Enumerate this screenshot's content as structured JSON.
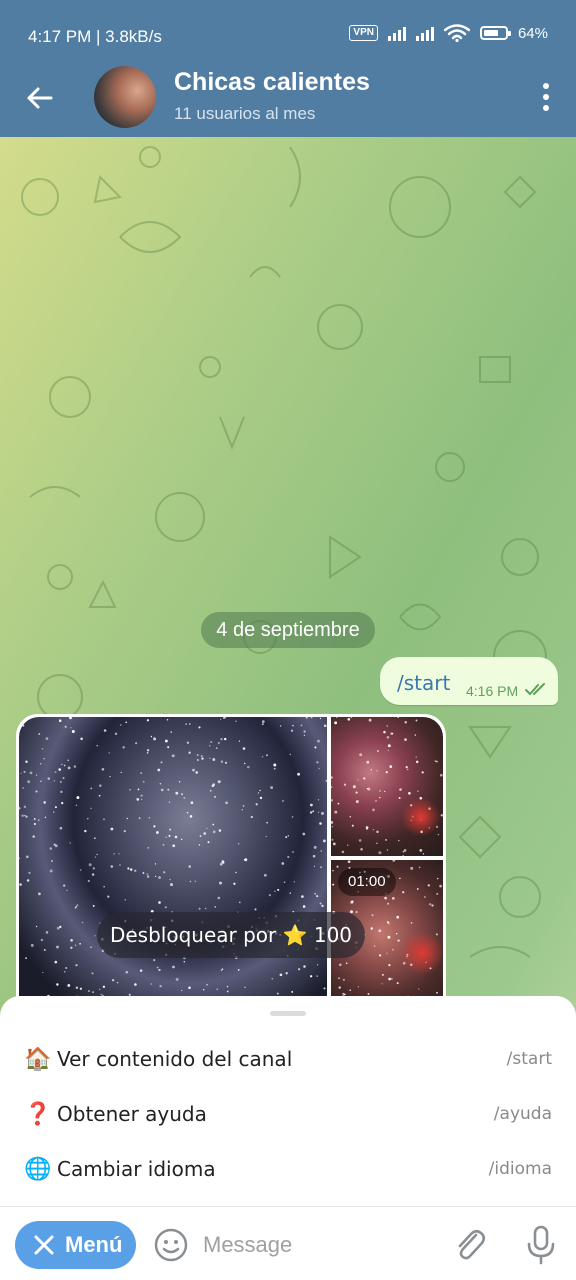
{
  "status_bar": {
    "time_speed": "4:17 PM | 3.8kB/s",
    "vpn": "VPN",
    "network": "4G",
    "battery": "64%",
    "icons": [
      "vpn-icon",
      "signal-icon",
      "wifi-icon",
      "battery-icon"
    ]
  },
  "header": {
    "title": "Chicas calientes",
    "subtitle": "11 usuarios al mes",
    "icons": [
      "back-arrow-icon",
      "more-vert-icon"
    ]
  },
  "chat": {
    "date": "4 de septiembre",
    "outgoing": {
      "text": "/start",
      "time": "4:16 PM",
      "status": "read"
    },
    "album": {
      "duration": "01:00",
      "unlock_label": "Desbloquear por ⭐ 100"
    }
  },
  "commands": [
    {
      "emoji": "🏠",
      "label": "Ver contenido del canal",
      "command": "/start"
    },
    {
      "emoji": "❓",
      "label": "Obtener ayuda",
      "command": "/ayuda"
    },
    {
      "emoji": "🌐",
      "label": "Cambiar idioma",
      "command": "/idioma"
    }
  ],
  "input_bar": {
    "menu_label": "Menú",
    "placeholder": "Message",
    "icons": [
      "close-icon",
      "emoji-icon",
      "attach-icon",
      "mic-icon"
    ]
  },
  "colors": {
    "header": "#527da3",
    "outgoing_bubble": "#effdde",
    "menu_button": "#5aa0e6",
    "link_text": "#3c77b0"
  }
}
